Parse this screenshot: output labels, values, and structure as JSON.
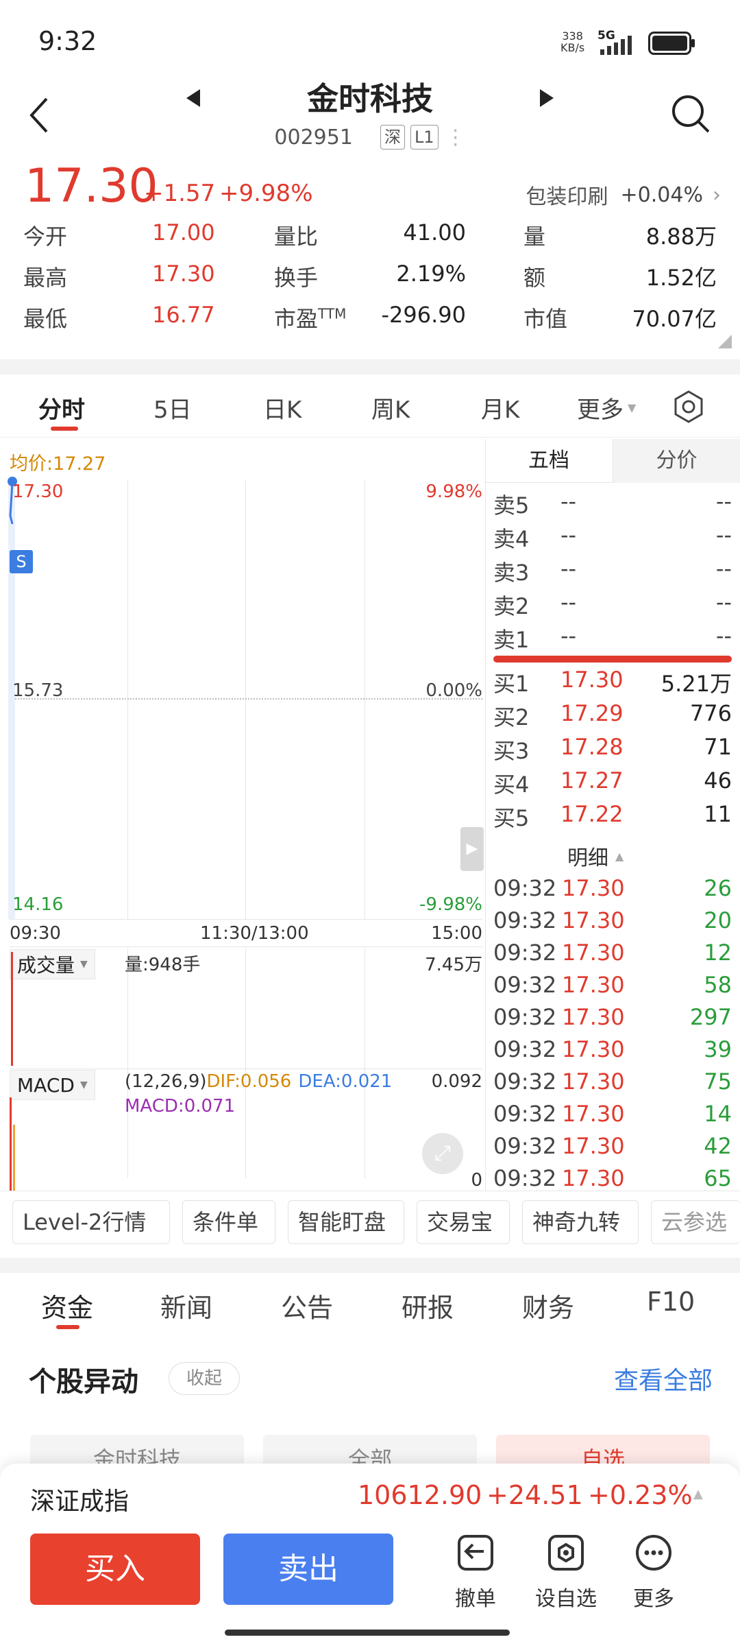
{
  "status": {
    "time": "9:32",
    "net_speed_value": "338",
    "net_speed_unit": "KB/s",
    "net_type": "5G"
  },
  "header": {
    "title": "金时科技",
    "code": "002951",
    "exchange": "深",
    "level": "L1"
  },
  "quote": {
    "price": "17.30",
    "change": "+1.57",
    "change_pct": "+9.98%",
    "sector_name": "包装印刷",
    "sector_pct": "+0.04%",
    "stats": [
      {
        "label": "今开",
        "value": "17.00"
      },
      {
        "label": "量比",
        "value": "41.00"
      },
      {
        "label": "量",
        "value": "8.88万"
      },
      {
        "label": "最高",
        "value": "17.30"
      },
      {
        "label": "换手",
        "value": "2.19%"
      },
      {
        "label": "额",
        "value": "1.52亿"
      },
      {
        "label": "最低",
        "value": "16.77"
      },
      {
        "label": "市盈",
        "label_sup": "TTM",
        "value": "-296.90"
      },
      {
        "label": "市值",
        "value": "70.07亿"
      }
    ]
  },
  "chart_tabs": [
    "分时",
    "5日",
    "日K",
    "周K",
    "月K",
    "更多"
  ],
  "chart": {
    "avg_price": "均价:17.27",
    "top_price": "17.30",
    "top_pct": "9.98%",
    "mid_price": "15.73",
    "mid_pct": "0.00%",
    "low_price": "14.16",
    "low_pct": "-9.98%",
    "time_start": "09:30",
    "time_mid": "11:30/13:00",
    "time_end": "15:00",
    "marker": "S",
    "volume_label": "成交量",
    "volume_value": "量:948手",
    "volume_max": "7.45万",
    "macd_label": "MACD",
    "macd_params": "(12,26,9)",
    "dif": "DIF:0.056",
    "dea": "DEA:0.021",
    "macd": "MACD:0.071",
    "macd_max": "0.092",
    "macd_zero": "0"
  },
  "orderbook": {
    "tabs": [
      "五档",
      "分价"
    ],
    "asks": [
      {
        "label": "卖5",
        "price": "--",
        "vol": "--"
      },
      {
        "label": "卖4",
        "price": "--",
        "vol": "--"
      },
      {
        "label": "卖3",
        "price": "--",
        "vol": "--"
      },
      {
        "label": "卖2",
        "price": "--",
        "vol": "--"
      },
      {
        "label": "卖1",
        "price": "--",
        "vol": "--"
      }
    ],
    "bids": [
      {
        "label": "买1",
        "price": "17.30",
        "vol": "5.21万"
      },
      {
        "label": "买2",
        "price": "17.29",
        "vol": "776"
      },
      {
        "label": "买3",
        "price": "17.28",
        "vol": "71"
      },
      {
        "label": "买4",
        "price": "17.27",
        "vol": "46"
      },
      {
        "label": "买5",
        "price": "17.22",
        "vol": "11"
      }
    ],
    "detail_label": "明细",
    "ticks": [
      {
        "time": "09:32",
        "price": "17.30",
        "vol": "26"
      },
      {
        "time": "09:32",
        "price": "17.30",
        "vol": "20"
      },
      {
        "time": "09:32",
        "price": "17.30",
        "vol": "12"
      },
      {
        "time": "09:32",
        "price": "17.30",
        "vol": "58"
      },
      {
        "time": "09:32",
        "price": "17.30",
        "vol": "297"
      },
      {
        "time": "09:32",
        "price": "17.30",
        "vol": "39"
      },
      {
        "time": "09:32",
        "price": "17.30",
        "vol": "75"
      },
      {
        "time": "09:32",
        "price": "17.30",
        "vol": "14"
      },
      {
        "time": "09:32",
        "price": "17.30",
        "vol": "42"
      },
      {
        "time": "09:32",
        "price": "17.30",
        "vol": "65"
      }
    ]
  },
  "tools": [
    "Level-2行情",
    "条件单",
    "智能盯盘",
    "交易宝",
    "神奇九转",
    "云参选"
  ],
  "sub_tabs": [
    "资金",
    "新闻",
    "公告",
    "研报",
    "财务",
    "F10"
  ],
  "section": {
    "title": "个股异动",
    "collapse": "收起",
    "view_all": "查看全部",
    "filters": [
      "金时科技",
      "全部",
      "自选"
    ]
  },
  "index_bar": {
    "name": "深证成指",
    "value": "10612.90",
    "change": "+24.51",
    "pct": "+0.23%"
  },
  "actions": {
    "buy": "买入",
    "sell": "卖出",
    "cancel": "撤单",
    "watch": "设自选",
    "more": "更多"
  }
}
